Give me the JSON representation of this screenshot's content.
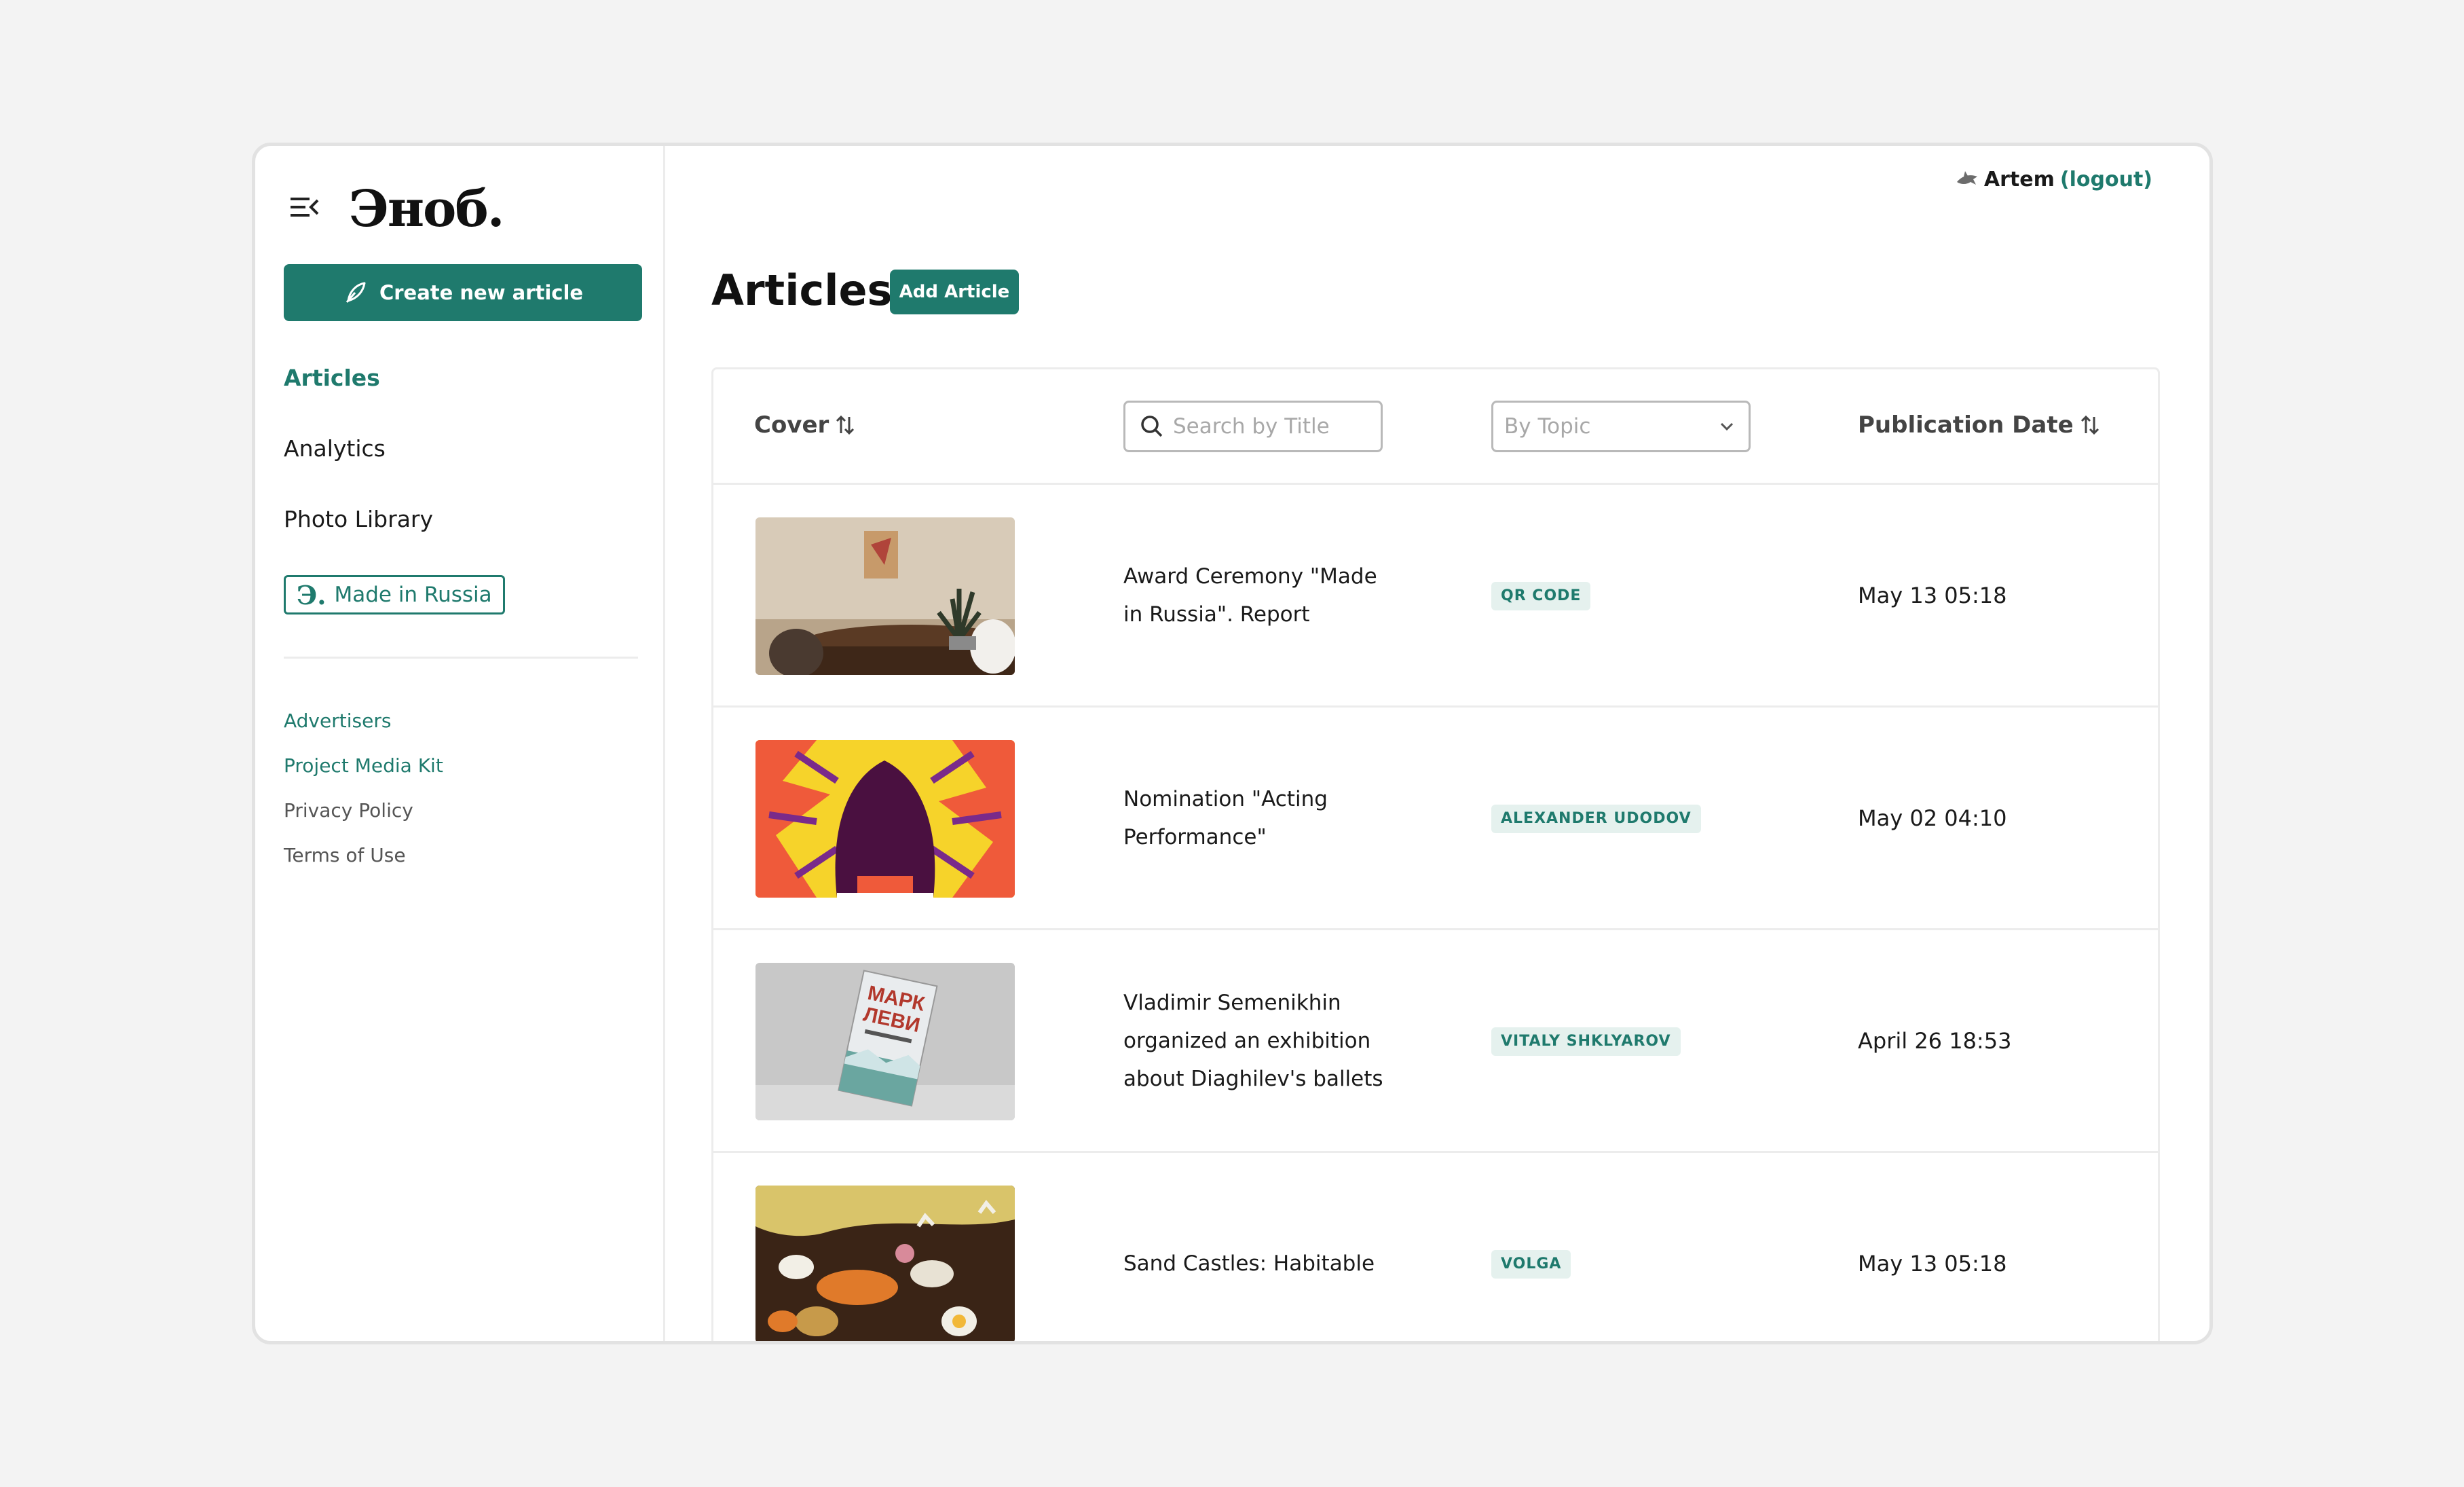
{
  "brand": {
    "logo_text": "Эноб."
  },
  "sidebar": {
    "create_label": "Create new article",
    "nav": [
      {
        "label": "Articles",
        "active": true
      },
      {
        "label": "Analytics",
        "active": false
      },
      {
        "label": "Photo Library",
        "active": false
      }
    ],
    "made_in_russia": {
      "mark": "Э.",
      "label": "Made in Russia"
    },
    "footer_links": [
      "Advertisers",
      "Project Media Kit",
      "Privacy Policy",
      "Terms of Use"
    ]
  },
  "user": {
    "name": "Artem",
    "logout": "(logout)"
  },
  "page": {
    "title": "Articles",
    "add_button": "Add Article"
  },
  "table": {
    "headers": {
      "cover": "Cover",
      "publication_date": "Publication Date"
    },
    "search_placeholder": "Search by Title",
    "topic_placeholder": "By Topic",
    "rows": [
      {
        "title": "Award Ceremony \"Made in Russia\". Report",
        "tag": "QR CODE",
        "date": "May 13 05:18",
        "cover": "interior"
      },
      {
        "title": "Nomination \"Acting Performance\"",
        "tag": "ALEXANDER UDODOV",
        "date": "May 02 04:10",
        "cover": "illustration"
      },
      {
        "title": "Vladimir Semenikhin organized an exhibition about Diaghilev's ballets",
        "tag": "VITALY SHKLYAROV",
        "date": "April 26 18:53",
        "cover": "book",
        "book_text": [
          "МАРК",
          "ЛЕВИ"
        ]
      },
      {
        "title": "Sand Castles: Habitable",
        "tag": "VOLGA",
        "date": "May 13 05:18",
        "cover": "food"
      }
    ]
  },
  "colors": {
    "accent": "#1f7a6d",
    "tag_bg": "#e5f1ee"
  }
}
